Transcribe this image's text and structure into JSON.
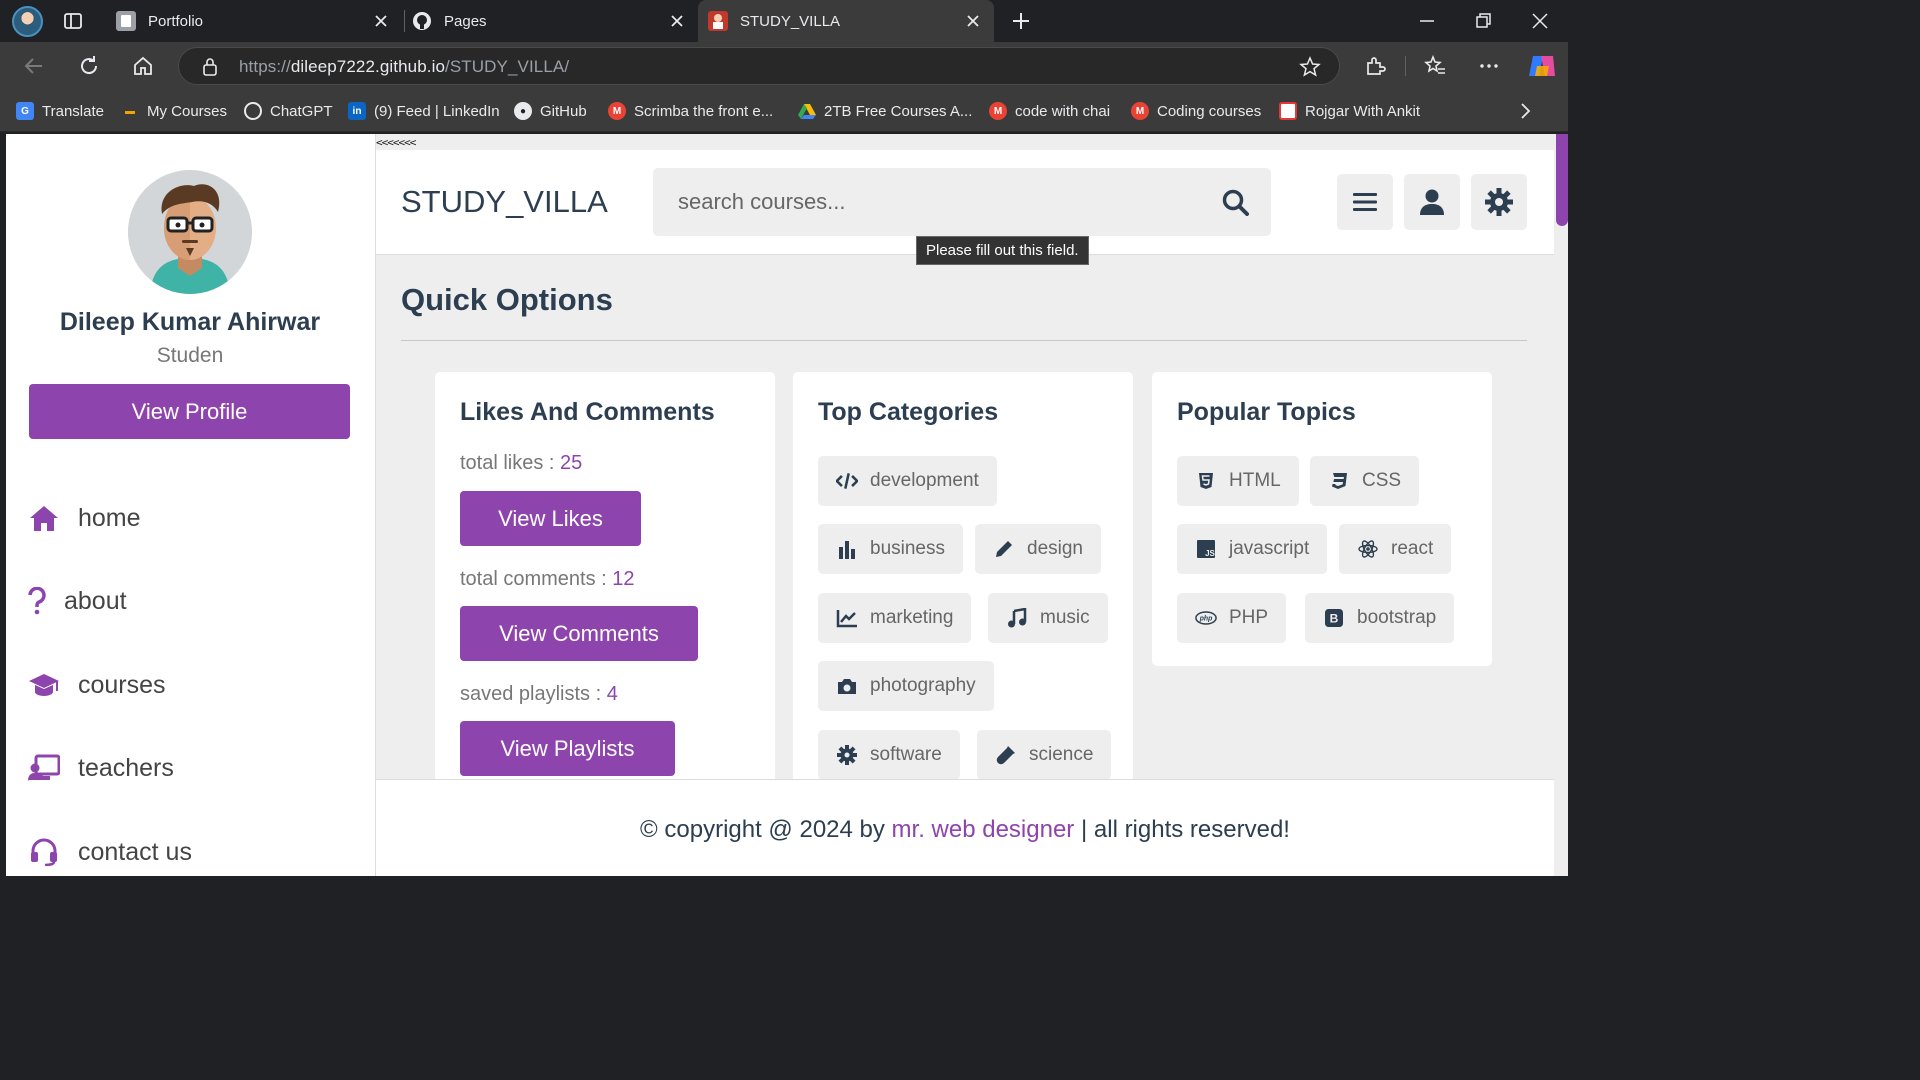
{
  "colors": {
    "accent": "#8e44ad",
    "heading": "#2c3e50",
    "chrome": "#202124"
  },
  "browser": {
    "tabs": [
      {
        "title": "Portfolio",
        "icon": "document-icon"
      },
      {
        "title": "Pages",
        "icon": "github-icon"
      },
      {
        "title": "STUDY_VILLA",
        "icon": "site-favicon",
        "active": true
      }
    ],
    "url_prefix": "https://",
    "url_host": "dileep7222.github.io",
    "url_path": "/STUDY_VILLA/",
    "bookmarks": [
      {
        "label": "Translate",
        "icon": "google-translate-icon",
        "color": "#4285f4"
      },
      {
        "label": "My Courses",
        "icon": "courses-icon",
        "color": "#f4a300"
      },
      {
        "label": "ChatGPT",
        "icon": "chatgpt-icon",
        "color": "#ffffff"
      },
      {
        "label": "(9) Feed | LinkedIn",
        "icon": "linkedin-icon",
        "color": "#0a66c2"
      },
      {
        "label": "GitHub",
        "icon": "github-icon",
        "color": "#ffffff"
      },
      {
        "label": "Scrimba the front e...",
        "icon": "gmail-icon",
        "color": "#ea4335"
      },
      {
        "label": "2TB Free Courses A...",
        "icon": "drive-icon",
        "color": "#34a853"
      },
      {
        "label": "code with chai",
        "icon": "gmail-icon",
        "color": "#ea4335"
      },
      {
        "label": "Coding courses",
        "icon": "gmail-icon",
        "color": "#ea4335"
      },
      {
        "label": "Rojgar With Ankit",
        "icon": "site-icon",
        "color": "#e53935"
      }
    ]
  },
  "sidebar": {
    "name": "Dileep Kumar Ahirwar",
    "role": "Studen",
    "profile_button": "View Profile",
    "nav": [
      {
        "label": "home",
        "icon": "home-icon"
      },
      {
        "label": "about",
        "icon": "question-icon"
      },
      {
        "label": "courses",
        "icon": "graduation-cap-icon"
      },
      {
        "label": "teachers",
        "icon": "teacher-icon"
      },
      {
        "label": "contact us",
        "icon": "headset-icon"
      }
    ]
  },
  "header": {
    "arrows": "<<<<<<<",
    "logo": "STUDY_VILLA",
    "search_placeholder": "search courses...",
    "tooltip": "Please fill out this field."
  },
  "main": {
    "section_title": "Quick Options",
    "likes_card": {
      "title": "Likes And Comments",
      "likes_label": "total likes : ",
      "likes_value": "25",
      "likes_button": "View Likes",
      "comments_label": "total comments : ",
      "comments_value": "12",
      "comments_button": "View Comments",
      "playlists_label": "saved playlists : ",
      "playlists_value": "4",
      "playlists_button": "View Playlists"
    },
    "categories_card": {
      "title": "Top Categories",
      "items": [
        {
          "label": "development",
          "icon": "code-icon"
        },
        {
          "label": "business",
          "icon": "chart-bar-icon"
        },
        {
          "label": "design",
          "icon": "pen-icon"
        },
        {
          "label": "marketing",
          "icon": "chart-line-icon"
        },
        {
          "label": "music",
          "icon": "music-icon"
        },
        {
          "label": "photography",
          "icon": "camera-icon"
        },
        {
          "label": "software",
          "icon": "cog-icon"
        },
        {
          "label": "science",
          "icon": "vial-icon"
        }
      ]
    },
    "topics_card": {
      "title": "Popular Topics",
      "items": [
        {
          "label": "HTML",
          "icon": "html5-icon"
        },
        {
          "label": "CSS",
          "icon": "css3-icon"
        },
        {
          "label": "javascript",
          "icon": "js-icon"
        },
        {
          "label": "react",
          "icon": "react-icon"
        },
        {
          "label": "PHP",
          "icon": "php-icon"
        },
        {
          "label": "bootstrap",
          "icon": "bootstrap-icon"
        }
      ]
    }
  },
  "footer": {
    "prefix": "© copyright @ 2024 by ",
    "author": "mr. web designer",
    "suffix": " | all rights reserved!"
  }
}
